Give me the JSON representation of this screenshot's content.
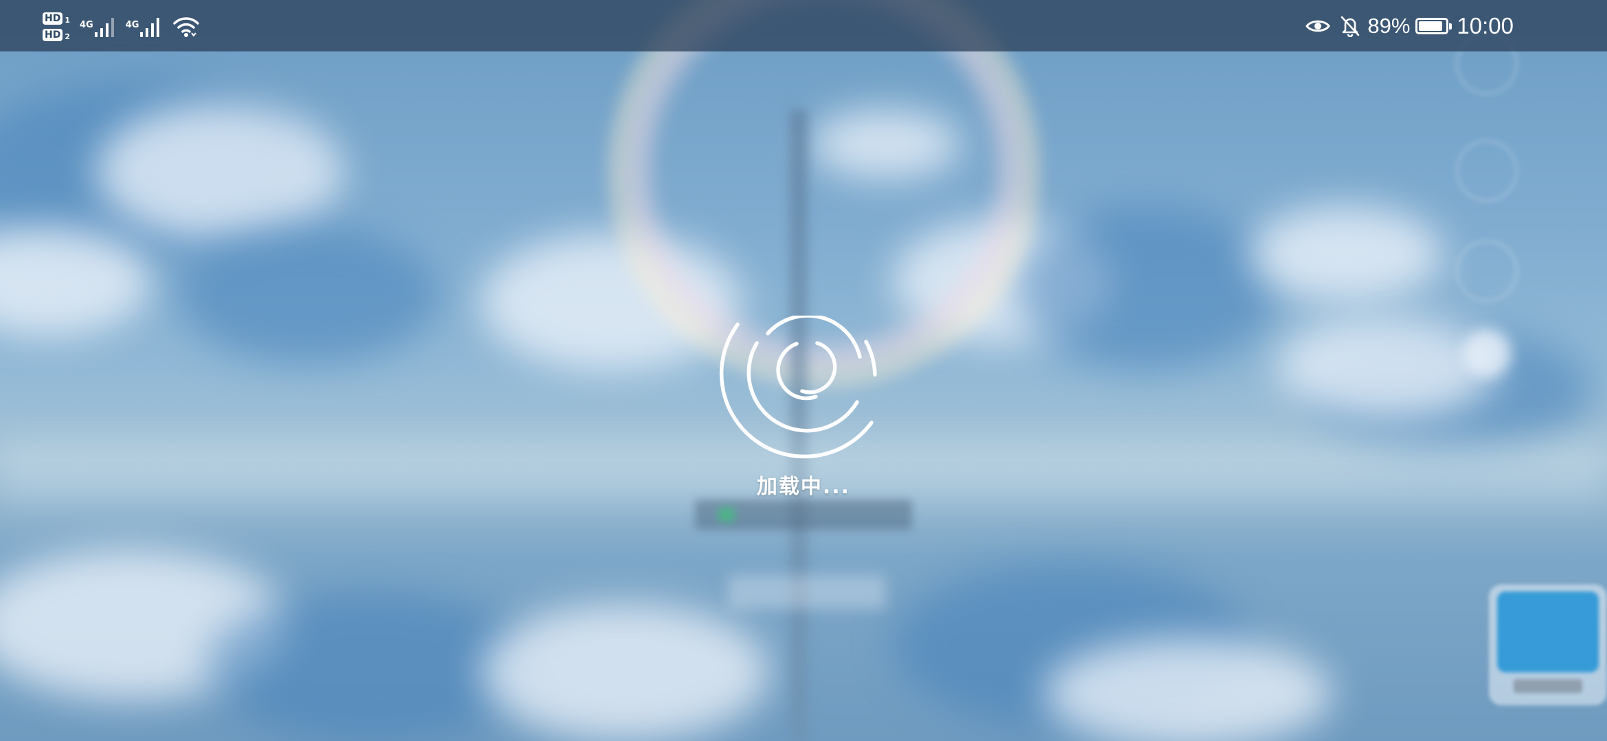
{
  "status_bar": {
    "sim1_badge": "HD",
    "sim1_index": "1",
    "sim2_badge": "HD",
    "sim2_index": "2",
    "signal1_label": "4G",
    "signal2_label": "4G",
    "battery_level": 0.89,
    "battery_text": "89%",
    "time": "10:00",
    "icons": [
      "eye-comfort-icon",
      "mute-bell-icon",
      "wifi-icon",
      "battery-icon",
      "cellular-signal-icon"
    ]
  },
  "loading": {
    "text": "加载中..."
  },
  "colors": {
    "status_bar_bg": "#283c55",
    "spinner": "#ffffff",
    "accent_blue": "#2896d7"
  }
}
